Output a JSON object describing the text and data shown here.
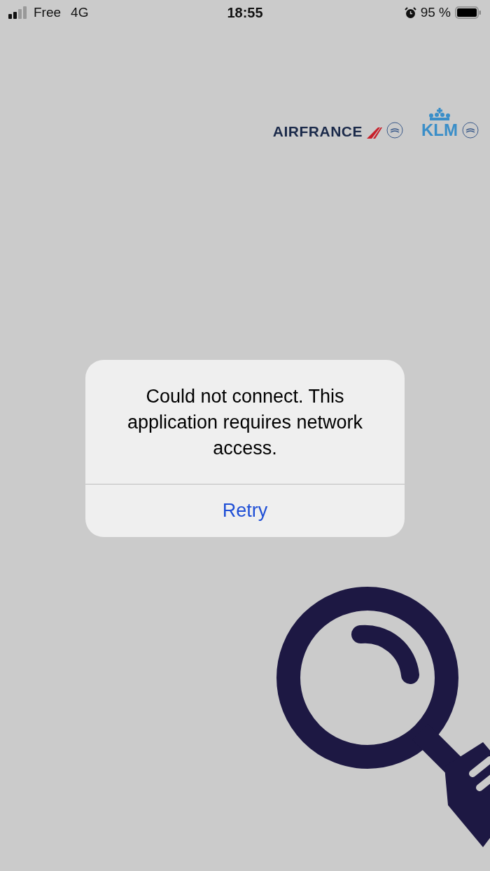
{
  "status_bar": {
    "carrier": "Free",
    "network": "4G",
    "time": "18:55",
    "battery": "95 %"
  },
  "partner_logos": {
    "first": "AIRFRANCE",
    "second": "KLM"
  },
  "alert": {
    "message": "Could not connect. This application requires network access.",
    "buttons": [
      "Retry"
    ]
  }
}
